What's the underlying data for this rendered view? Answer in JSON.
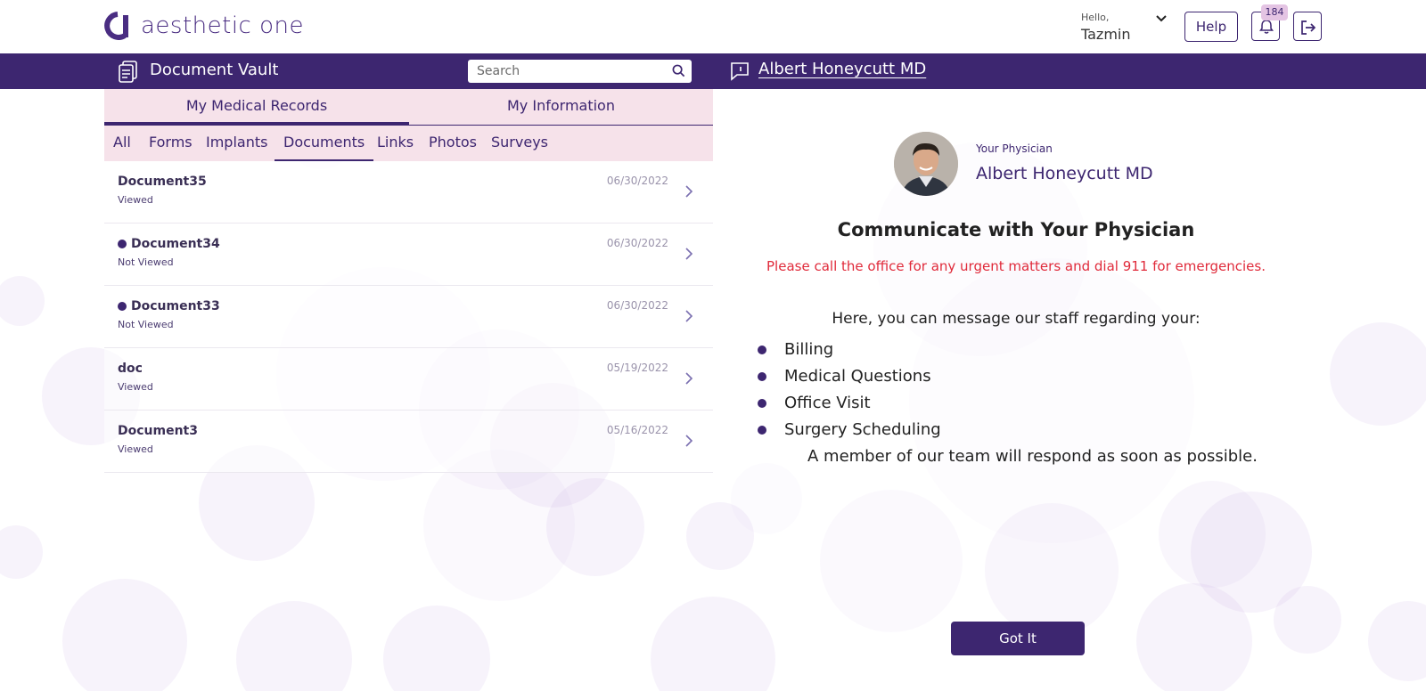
{
  "brand": {
    "name": "aesthetic one",
    "color": "#3d2670"
  },
  "user": {
    "greeting": "Hello,",
    "name": "Tazmin"
  },
  "toolbar": {
    "help_label": "Help",
    "notification_count": "184"
  },
  "vault": {
    "title": "Document Vault"
  },
  "search": {
    "placeholder": "Search"
  },
  "physician_link": "Albert Honeycutt MD",
  "tabs_main": [
    {
      "label": "My Medical Records",
      "active": true
    },
    {
      "label": "My Information",
      "active": false
    }
  ],
  "tabs_sub": [
    {
      "label": "All"
    },
    {
      "label": "Forms"
    },
    {
      "label": "Implants"
    },
    {
      "label": "Documents",
      "active": true
    },
    {
      "label": "Links"
    },
    {
      "label": "Photos"
    },
    {
      "label": "Surveys"
    }
  ],
  "documents": [
    {
      "name": "Document35",
      "status": "Viewed",
      "date": "06/30/2022",
      "unread": false
    },
    {
      "name": "Document34",
      "status": "Not Viewed",
      "date": "06/30/2022",
      "unread": true
    },
    {
      "name": "Document33",
      "status": "Not Viewed",
      "date": "06/30/2022",
      "unread": true
    },
    {
      "name": "doc",
      "status": "Viewed",
      "date": "05/19/2022",
      "unread": false
    },
    {
      "name": "Document3",
      "status": "Viewed",
      "date": "05/16/2022",
      "unread": false
    }
  ],
  "physician": {
    "label": "Your Physician",
    "name": "Albert Honeycutt MD"
  },
  "message": {
    "title": "Communicate with Your Physician",
    "urgent": "Please call the office for any urgent matters and dial 911 for emergencies.",
    "intro": "Here, you can message our staff regarding your:",
    "topics": [
      "Billing",
      "Medical Questions",
      "Office Visit",
      "Surgery Scheduling"
    ],
    "respond": "A member of our team will respond as soon as possible.",
    "button": "Got It"
  }
}
